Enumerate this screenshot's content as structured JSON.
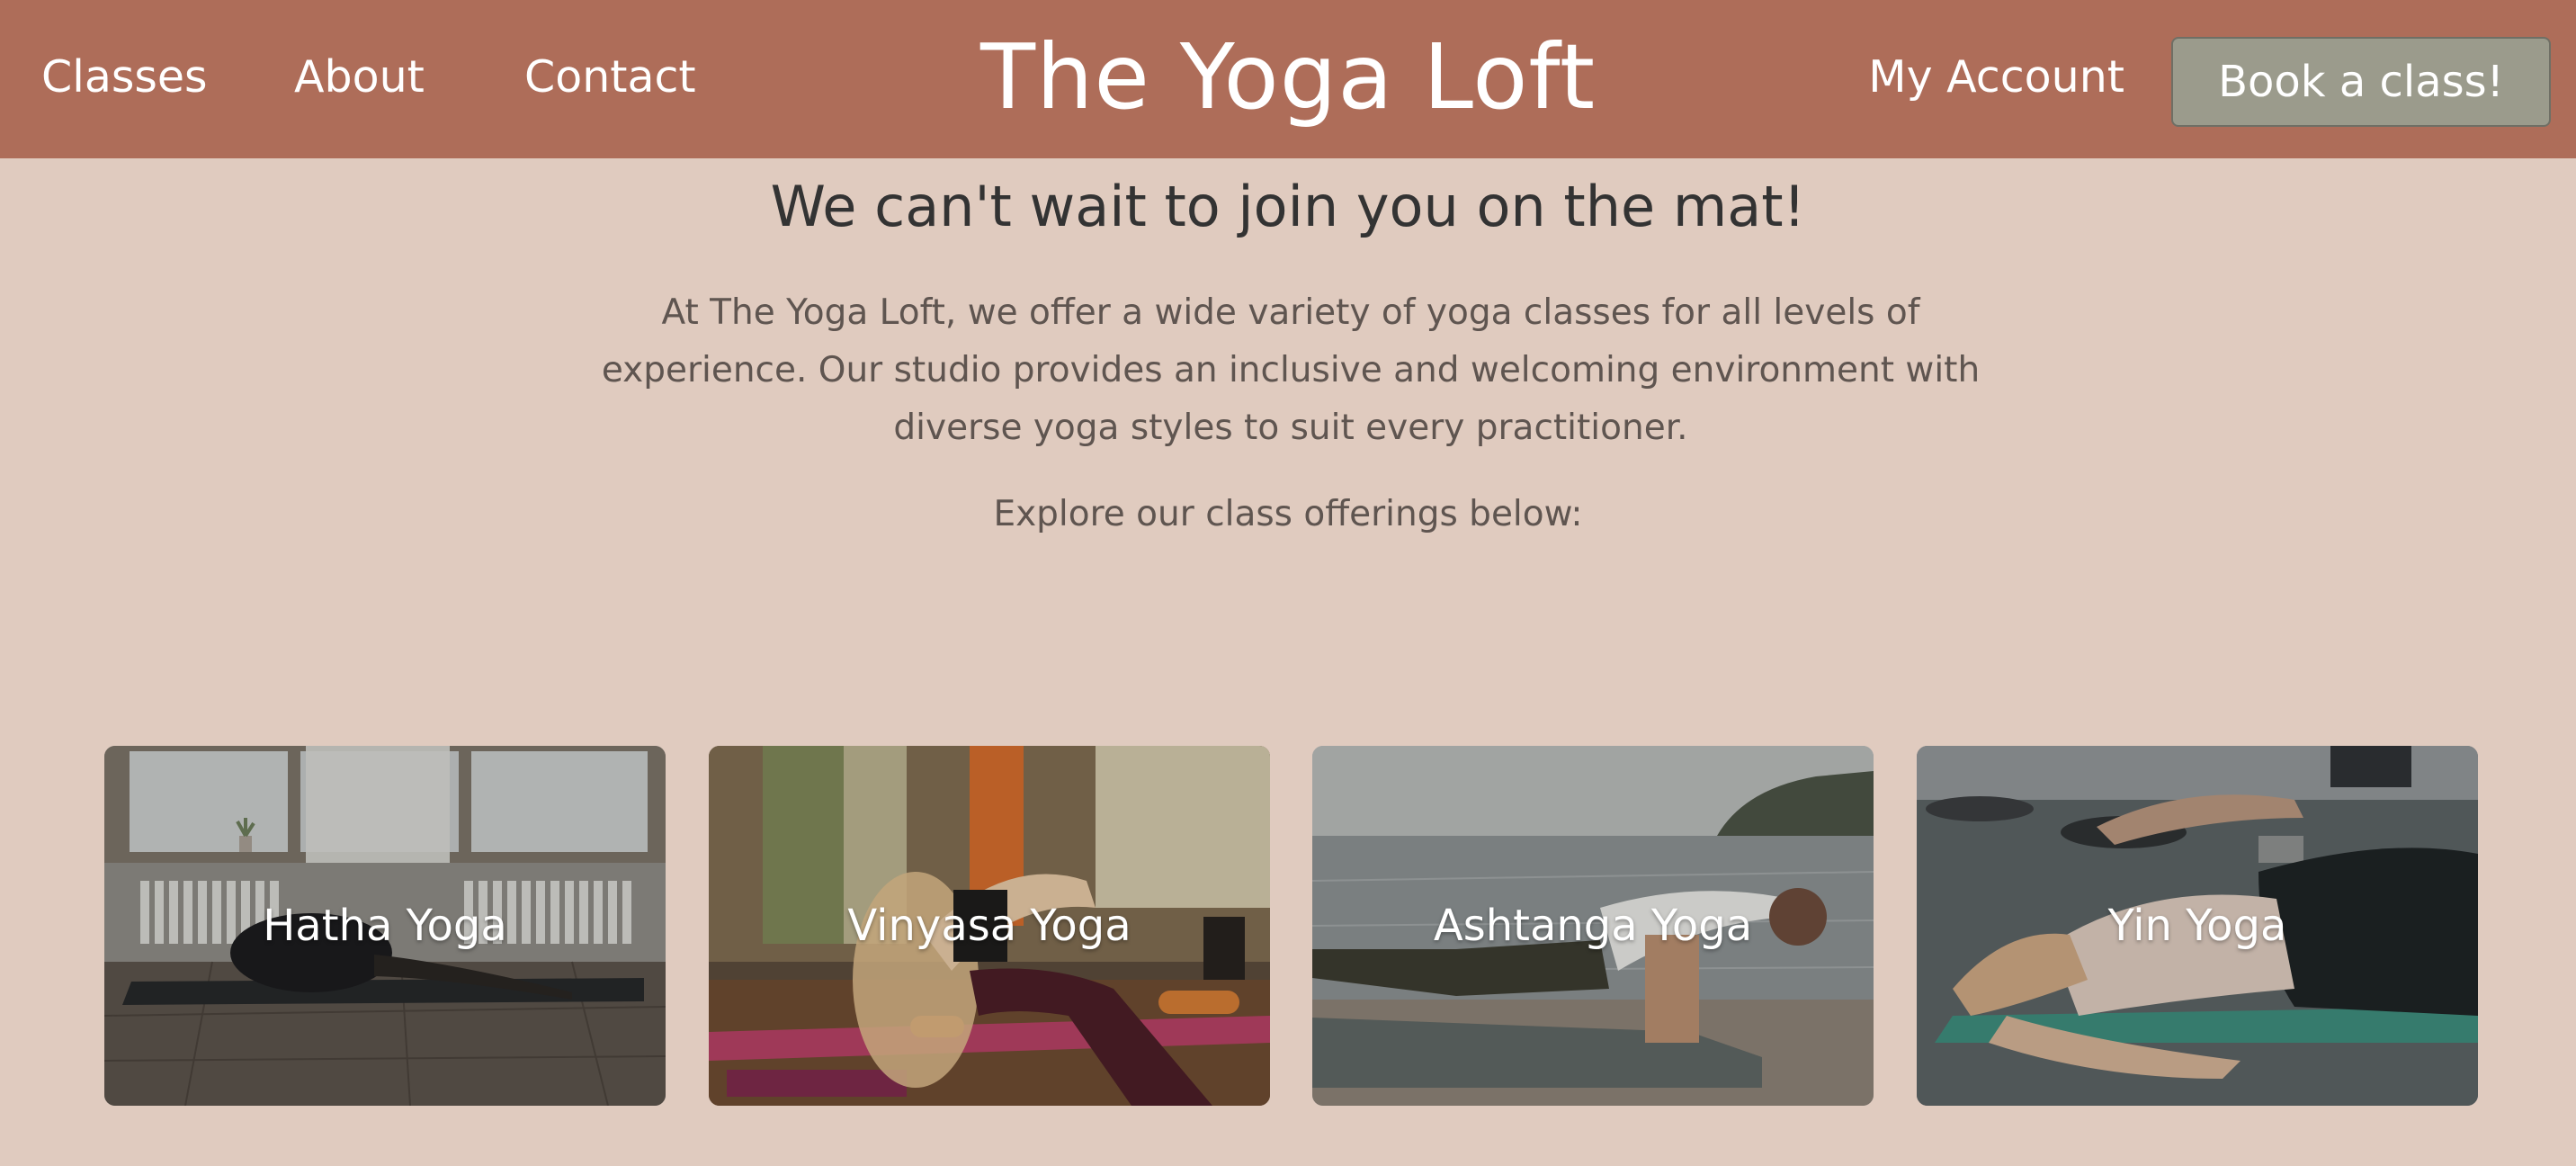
{
  "header": {
    "nav": {
      "classes": "Classes",
      "about": "About",
      "contact": "Contact"
    },
    "title": "The Yoga Loft",
    "account_label": "My Account",
    "cta_label": "Book a class!"
  },
  "intro": {
    "headline": "We can't wait to join you on the mat!",
    "description": "At The Yoga Loft, we offer a wide variety of yoga classes for all levels of experience. Our studio provides an inclusive and welcoming environment with diverse yoga styles to suit every practitioner.",
    "explore": "Explore our class offerings below:"
  },
  "classes": [
    {
      "label": "Hatha Yoga"
    },
    {
      "label": "Vinyasa Yoga"
    },
    {
      "label": "Ashtanga Yoga"
    },
    {
      "label": "Yin Yoga"
    }
  ],
  "colors": {
    "header_bg": "#ae6d59",
    "page_bg": "#e0cbbf",
    "button_bg": "#9b9b8c",
    "heading_text": "#333333",
    "body_text": "#5f5550"
  }
}
